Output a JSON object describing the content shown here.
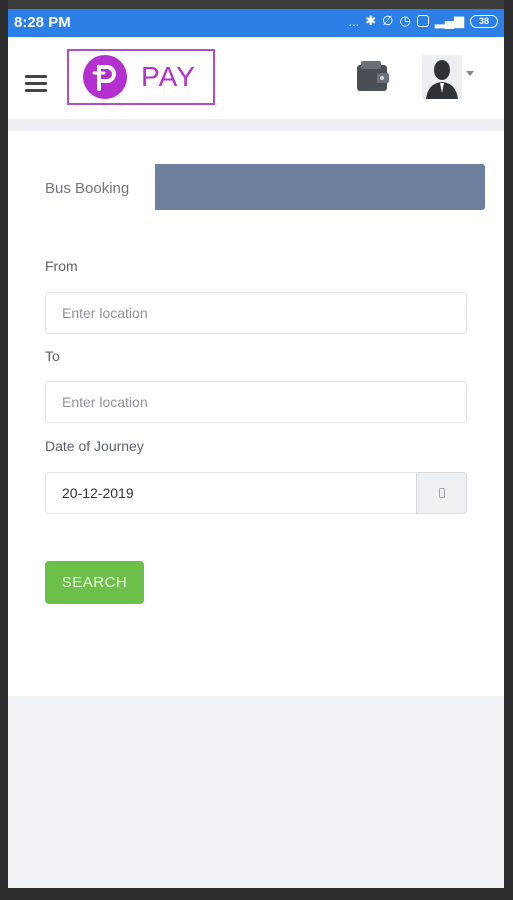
{
  "status_bar": {
    "time": "8:28 PM",
    "dots": "...",
    "battery_label": "38"
  },
  "header": {
    "logo_text": "PAY",
    "icons": [
      "menu-icon",
      "wallet-icon",
      "user-avatar-icon",
      "chevron-down-icon"
    ]
  },
  "booking": {
    "breadcrumb": "Bus Booking",
    "from_label": "From",
    "from_placeholder": "Enter location",
    "to_label": "To",
    "to_placeholder": "Enter location",
    "date_label": "Date of Journey",
    "date_value": "20-12-2019",
    "search_label": "SEARCH"
  },
  "colors": {
    "status_bar": "#2c7fe6",
    "brand": "#b32fd0",
    "search_button": "#6cc04a",
    "crumb_bar": "#6e809f"
  }
}
